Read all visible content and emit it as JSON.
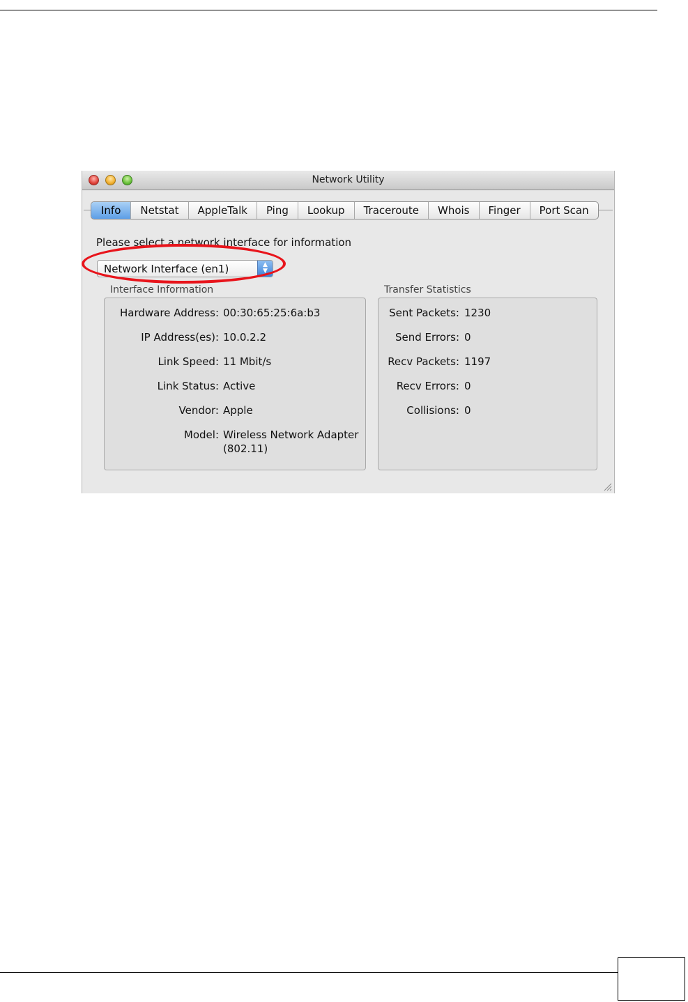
{
  "window": {
    "title": "Network Utility",
    "tabs": [
      "Info",
      "Netstat",
      "AppleTalk",
      "Ping",
      "Lookup",
      "Traceroute",
      "Whois",
      "Finger",
      "Port Scan"
    ],
    "active_tab": "Info",
    "prompt": "Please select a network interface for information",
    "interface_select": "Network Interface (en1)",
    "interface_info": {
      "label": "Interface Information",
      "rows": [
        {
          "k": "Hardware Address:",
          "v": "00:30:65:25:6a:b3"
        },
        {
          "k": "IP Address(es):",
          "v": "10.0.2.2"
        },
        {
          "k": "Link Speed:",
          "v": "11 Mbit/s"
        },
        {
          "k": "Link Status:",
          "v": "Active"
        },
        {
          "k": "Vendor:",
          "v": "Apple"
        },
        {
          "k": "Model:",
          "v": "Wireless Network Adapter",
          "v2": "(802.11)"
        }
      ]
    },
    "transfer_stats": {
      "label": "Transfer Statistics",
      "rows": [
        {
          "k": "Sent Packets:",
          "v": "1230"
        },
        {
          "k": "Send Errors:",
          "v": "0"
        },
        {
          "k": "Recv Packets:",
          "v": "1197"
        },
        {
          "k": "Recv Errors:",
          "v": "0"
        },
        {
          "k": "Collisions:",
          "v": "0"
        }
      ]
    }
  },
  "colors": {
    "highlight": "#e8141b",
    "active_tab": "#5d9ee6"
  },
  "icons": [
    "close-button",
    "minimize-button",
    "zoom-button",
    "select-arrows-icon",
    "resize-grip-icon"
  ]
}
